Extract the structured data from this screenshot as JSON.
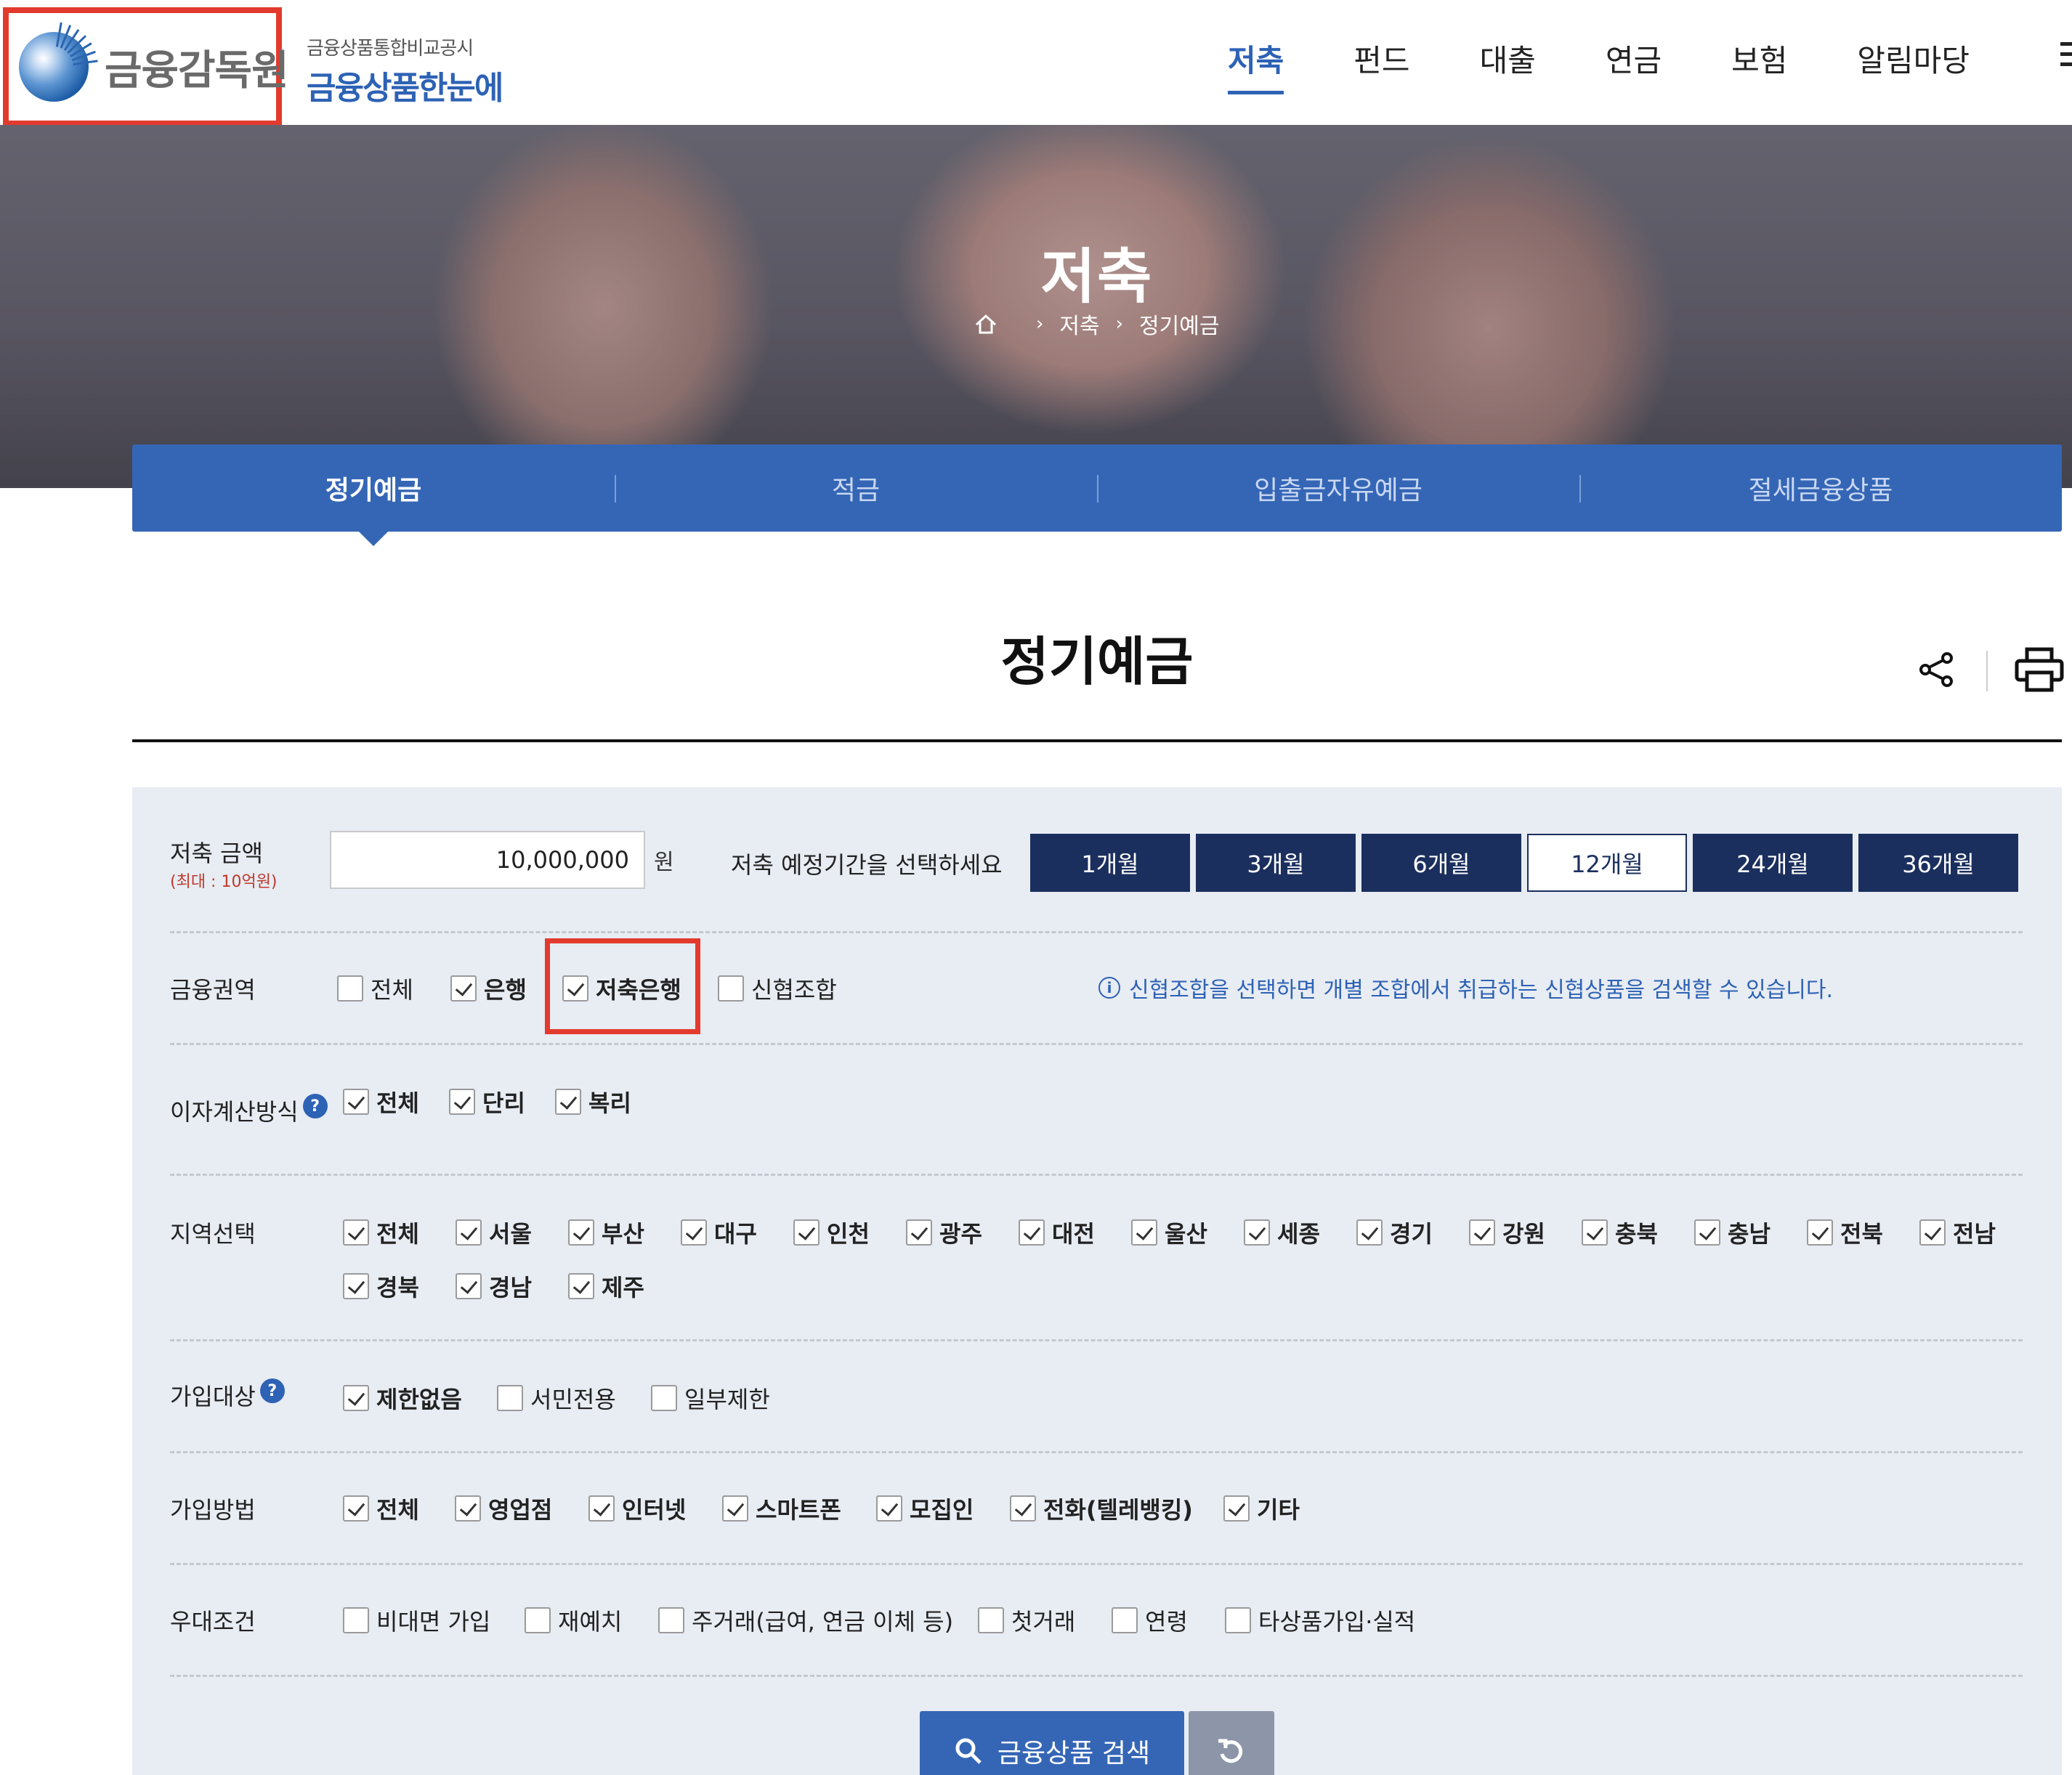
{
  "header": {
    "org_name": "금융감독원",
    "brand_sub": "금융상품통합비교공시",
    "brand_main": "금융상품한눈에",
    "nav": [
      "저축",
      "펀드",
      "대출",
      "연금",
      "보험",
      "알림마당"
    ]
  },
  "hero": {
    "title": "저축",
    "breadcrumb": [
      "저축",
      "정기예금"
    ]
  },
  "subtabs": [
    "정기예금",
    "적금",
    "입출금자유예금",
    "절세금융상품"
  ],
  "page": {
    "title": "정기예금"
  },
  "filters": {
    "amount": {
      "label": "저축 금액",
      "limit": "(최대 : 10억원)",
      "value": "10,000,000",
      "unit": "원"
    },
    "period": {
      "label": "저축 예정기간을 선택하세요",
      "options": [
        "1개월",
        "3개월",
        "6개월",
        "12개월",
        "24개월",
        "36개월"
      ],
      "selected": "12개월"
    },
    "sector": {
      "label": "금융권역",
      "options": [
        {
          "label": "전체",
          "checked": false
        },
        {
          "label": "은행",
          "checked": true
        },
        {
          "label": "저축은행",
          "checked": true
        },
        {
          "label": "신협조합",
          "checked": false
        }
      ],
      "note": "신협조합을 선택하면 개별 조합에서 취급하는 신협상품을 검색할 수 있습니다."
    },
    "interest": {
      "label": "이자계산방식",
      "options": [
        {
          "label": "전체",
          "checked": true
        },
        {
          "label": "단리",
          "checked": true
        },
        {
          "label": "복리",
          "checked": true
        }
      ]
    },
    "region": {
      "label": "지역선택",
      "options": [
        {
          "label": "전체",
          "checked": true
        },
        {
          "label": "서울",
          "checked": true
        },
        {
          "label": "부산",
          "checked": true
        },
        {
          "label": "대구",
          "checked": true
        },
        {
          "label": "인천",
          "checked": true
        },
        {
          "label": "광주",
          "checked": true
        },
        {
          "label": "대전",
          "checked": true
        },
        {
          "label": "울산",
          "checked": true
        },
        {
          "label": "세종",
          "checked": true
        },
        {
          "label": "경기",
          "checked": true
        },
        {
          "label": "강원",
          "checked": true
        },
        {
          "label": "충북",
          "checked": true
        },
        {
          "label": "충남",
          "checked": true
        },
        {
          "label": "전북",
          "checked": true
        },
        {
          "label": "전남",
          "checked": true
        },
        {
          "label": "경북",
          "checked": true
        },
        {
          "label": "경남",
          "checked": true
        },
        {
          "label": "제주",
          "checked": true
        }
      ]
    },
    "target": {
      "label": "가입대상",
      "options": [
        {
          "label": "제한없음",
          "checked": true
        },
        {
          "label": "서민전용",
          "checked": false
        },
        {
          "label": "일부제한",
          "checked": false
        }
      ]
    },
    "method": {
      "label": "가입방법",
      "options": [
        {
          "label": "전체",
          "checked": true
        },
        {
          "label": "영업점",
          "checked": true
        },
        {
          "label": "인터넷",
          "checked": true
        },
        {
          "label": "스마트폰",
          "checked": true
        },
        {
          "label": "모집인",
          "checked": true
        },
        {
          "label": "전화(텔레뱅킹)",
          "checked": true
        },
        {
          "label": "기타",
          "checked": true
        }
      ]
    },
    "preference": {
      "label": "우대조건",
      "options": [
        {
          "label": "비대면 가입",
          "checked": false
        },
        {
          "label": "재예치",
          "checked": false
        },
        {
          "label": "주거래(급여, 연금 이체 등)",
          "checked": false
        },
        {
          "label": "첫거래",
          "checked": false
        },
        {
          "label": "연령",
          "checked": false
        },
        {
          "label": "타상품가입·실적",
          "checked": false
        }
      ]
    }
  },
  "actions": {
    "search": "금융상품 검색"
  },
  "colors": {
    "brand_blue": "#3566b6",
    "navy": "#1b2f5e",
    "highlight_red": "#e23b2e"
  }
}
